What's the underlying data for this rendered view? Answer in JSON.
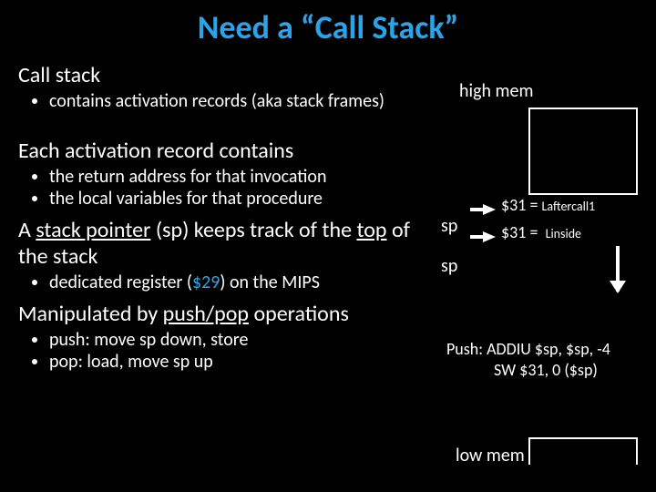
{
  "title": "Need a “Call Stack”",
  "sections": {
    "s1": {
      "heading": "Call stack",
      "bullets": [
        "contains activation records (aka stack frames)"
      ]
    },
    "s2": {
      "heading": "Each activation record contains",
      "bullets": [
        "the return address for that invocation",
        "the local variables for that procedure"
      ]
    },
    "s3": {
      "heading_pre": "A ",
      "heading_sp": "stack pointer",
      "heading_mid": " (sp) keeps track of the ",
      "heading_top": "top",
      "heading_post": " of the stack",
      "bullets_pre": "dedicated register (",
      "bullets_reg": "$29",
      "bullets_post": ") on the MIPS"
    },
    "s4": {
      "heading_pre": "Manipulated by ",
      "heading_ops": "push/pop",
      "heading_post": " operations",
      "bullets": [
        "push: move sp down, store",
        "pop: load, move sp up"
      ]
    }
  },
  "diagram": {
    "high_mem": "high mem",
    "low_mem": "low mem",
    "sp": "sp",
    "reg31": "$31 = ",
    "lab1": "Laftercall1",
    "lab2": "Linside",
    "push_line1": "Push: ADDIU $sp, $sp, -4",
    "push_line2": "SW $31, 0 ($sp)"
  }
}
